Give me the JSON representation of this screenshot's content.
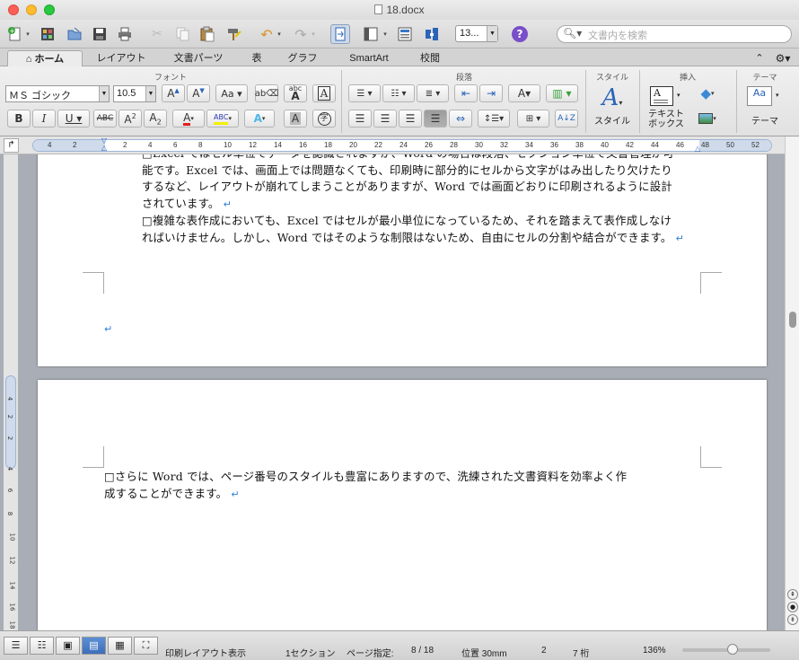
{
  "window": {
    "title": "18.docx"
  },
  "toolbar": {
    "zoom_value": "13...",
    "search_placeholder": "文書内を検索"
  },
  "ribbon_tabs": [
    "ホーム",
    "レイアウト",
    "文書パーツ",
    "表",
    "グラフ",
    "SmartArt",
    "校閲"
  ],
  "ribbon": {
    "group_font": "フォント",
    "group_paragraph": "段落",
    "group_style": "スタイル",
    "group_insert": "挿入",
    "group_theme": "テーマ",
    "font_name": "ＭＳ ゴシック",
    "font_size": "10.5",
    "style_button": "スタイル",
    "textbox_button_line1": "テキスト",
    "textbox_button_line2": "ボックス",
    "theme_button": "テーマ"
  },
  "ruler": {
    "numbers": [
      "4",
      "2",
      "2",
      "4",
      "6",
      "8",
      "10",
      "12",
      "14",
      "16",
      "18",
      "20",
      "22",
      "24",
      "26",
      "28",
      "30",
      "32",
      "34",
      "36",
      "38",
      "40",
      "42",
      "44",
      "46",
      "48",
      "50",
      "52"
    ]
  },
  "page1": {
    "line0": "□Excel ではセル単位でデータを認識されますが、Word の場合は段落、セクション単位で文書管理が可",
    "line1": "能です。Excel では、画面上では問題なくても、印刷時に部分的にセルから文字がはみ出したり欠けたり",
    "line2": "するなど、レイアウトが崩れてしまうことがありますが、Word では画面どおりに印刷されるように設計",
    "line3": "されています。",
    "line4": "□複雑な表作成においても、Excel ではセルが最小単位になっているため、それを踏まえて表作成しなけ",
    "line5": "ればいけません。しかし、Word ではそのような制限はないため、自由にセルの分割や結合ができます。"
  },
  "page2": {
    "line1": "□さらに Word では、ページ番号のスタイルも豊富にありますので、洗練された文書資料を効率よく作",
    "line2": "成することができます。"
  },
  "return_mark": "↵",
  "status": {
    "view_name": "印刷レイアウト表示",
    "section": "1セクション",
    "page_label": "ページ指定:",
    "page_value": "8 / 18",
    "position": "位置 30mm",
    "line": "2",
    "column": "7 桁",
    "zoom": "136%"
  }
}
